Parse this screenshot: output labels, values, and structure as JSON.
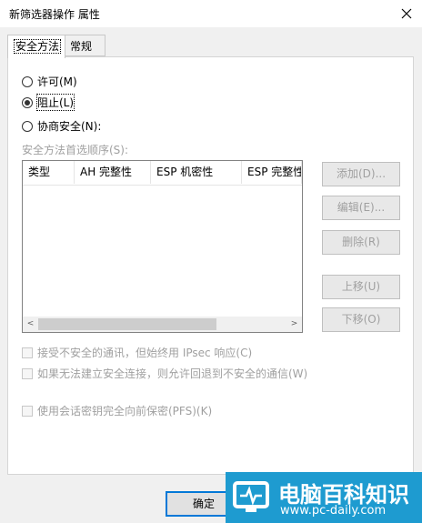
{
  "window": {
    "title": "新筛选器操作 属性"
  },
  "tabs": [
    {
      "label": "安全方法",
      "active": true
    },
    {
      "label": "常规",
      "active": false
    }
  ],
  "radios": [
    {
      "label": "许可(M)",
      "checked": false
    },
    {
      "label": "阻止(L)",
      "checked": true
    },
    {
      "label": "协商安全(N):",
      "checked": false
    }
  ],
  "methods": {
    "label": "安全方法首选顺序(S):",
    "columns": [
      "类型",
      "AH 完整性",
      "ESP 机密性",
      "ESP 完整性"
    ],
    "scroll_left": "<",
    "scroll_right": ">"
  },
  "buttons": {
    "add": "添加(D)...",
    "edit": "编辑(E)...",
    "delete": "删除(R)",
    "move_up": "上移(U)",
    "move_down": "下移(O)",
    "ok": "确定"
  },
  "checkboxes": [
    {
      "label": "接受不安全的通讯，但始终用 IPsec 响应(C)",
      "checked": false
    },
    {
      "label": "如果无法建立安全连接，则允许回退到不安全的通信(W)",
      "checked": false
    },
    {
      "label": "使用会话密钥完全向前保密(PFS)(K)",
      "checked": false
    }
  ],
  "watermark": {
    "brand": "电脑百科知识",
    "url": "www.pc-daily.com"
  },
  "colors": {
    "accent": "#0078d7",
    "watermark_bg": "#1e9bd0",
    "disabled_text": "#a0a0a0"
  }
}
